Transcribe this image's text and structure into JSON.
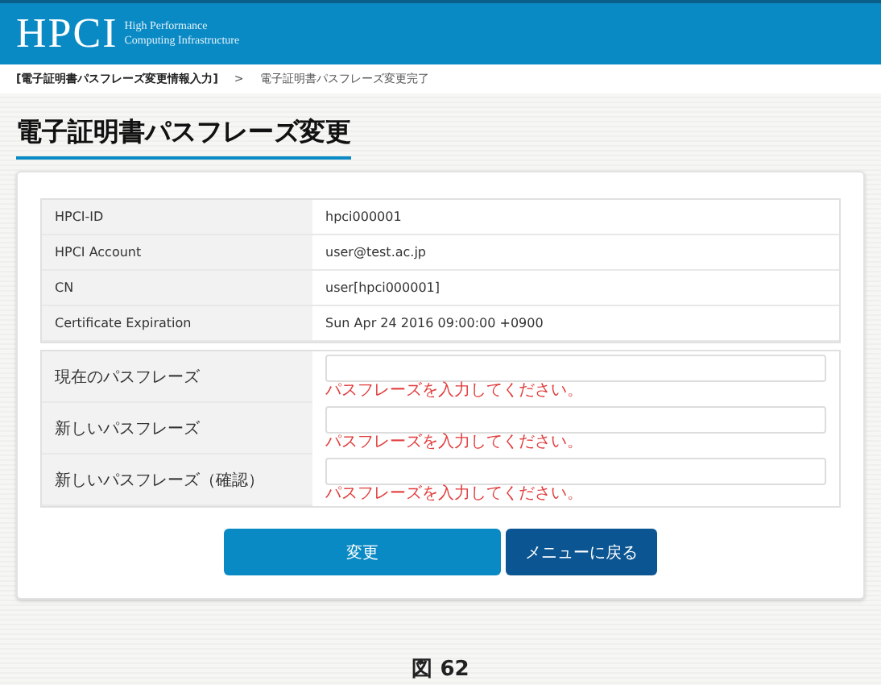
{
  "header": {
    "logo": "HPCI",
    "subtitle_lines": [
      "High Performance",
      "Computing Infrastructure"
    ]
  },
  "breadcrumb": [
    {
      "label": "[電子証明書パスフレーズ変更情報入力]",
      "selected": true
    },
    {
      "label": "電子証明書パスフレーズ変更完了",
      "selected": false
    }
  ],
  "breadcrumb_separator": ">",
  "page_title": "電子証明書パスフレーズ変更",
  "info_rows": [
    {
      "label": "HPCI-ID",
      "value": "hpci000001"
    },
    {
      "label": "HPCI Account",
      "value": "user@test.ac.jp"
    },
    {
      "label": "CN",
      "value": "user[hpci000001]"
    },
    {
      "label": "Certificate Expiration",
      "value": "Sun Apr 24 2016 09:00:00 +0900"
    }
  ],
  "form_rows": [
    {
      "label": "現在のパスフレーズ",
      "error": "パスフレーズを入力してください。"
    },
    {
      "label": "新しいパスフレーズ",
      "error": "パスフレーズを入力してください。"
    },
    {
      "label": "新しいパスフレーズ（確認）",
      "error": "パスフレーズを入力してください。"
    }
  ],
  "buttons": [
    {
      "label": "変更",
      "kind": "primary"
    },
    {
      "label": "メニューに戻る",
      "kind": "secondary"
    }
  ],
  "caption": "図 62"
}
